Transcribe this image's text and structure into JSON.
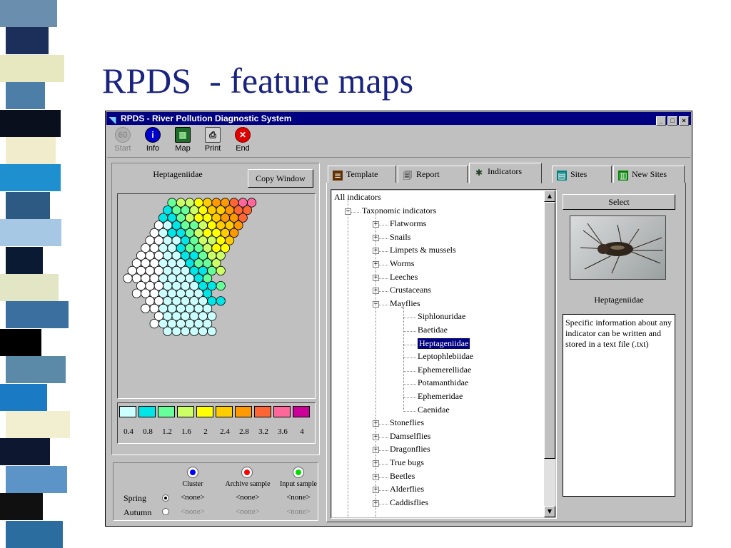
{
  "slide": {
    "title": "RPDS  - feature maps"
  },
  "window": {
    "title": "RPDS - River Pollution Diagnostic System"
  },
  "toolbar": {
    "buttons": [
      {
        "label": "Start",
        "icon": "start-icon",
        "enabled": false
      },
      {
        "label": "Info",
        "icon": "info-icon",
        "enabled": true
      },
      {
        "label": "Map",
        "icon": "map-icon",
        "enabled": true
      },
      {
        "label": "Print",
        "icon": "printer-icon",
        "enabled": true
      },
      {
        "label": "End",
        "icon": "stop-icon",
        "enabled": true
      }
    ]
  },
  "map_panel": {
    "title": "Heptageniidae",
    "copy_button": "Copy Window",
    "legend": {
      "colors": [
        "#ccffff",
        "#00e6e6",
        "#66ff99",
        "#ccff66",
        "#ffff00",
        "#ffcc00",
        "#ff9900",
        "#ff6633",
        "#ff6699",
        "#cc0099"
      ],
      "labels": [
        "0.4",
        "0.8",
        "1.2",
        "1.6",
        "2",
        "2.4",
        "2.8",
        "3.2",
        "3.6",
        "4"
      ]
    }
  },
  "samples": {
    "headers": [
      "Cluster",
      "Archive sample",
      "Input sample"
    ],
    "marker_colors": [
      "#0000ff",
      "#ff0000",
      "#00dd00"
    ],
    "rows": [
      {
        "label": "Spring",
        "selected": true,
        "values": [
          "<none>",
          "<none>",
          "<none>"
        ]
      },
      {
        "label": "Autumn",
        "selected": false,
        "values": [
          "<none>",
          "<none>",
          "<none>"
        ]
      }
    ]
  },
  "tabs": [
    {
      "label": "Template",
      "icon": "template-icon"
    },
    {
      "label": "Report",
      "icon": "report-icon"
    },
    {
      "label": "Indicators",
      "icon": "indicators-icon",
      "active": true
    },
    {
      "label": "Sites",
      "icon": "sites-icon"
    },
    {
      "label": "New Sites",
      "icon": "new-sites-icon"
    }
  ],
  "tree": {
    "root": "All indicators",
    "group": "Taxonomic indicators",
    "items_before": [
      "Flatworms",
      "Snails",
      "Limpets & mussels",
      "Worms",
      "Leeches",
      "Crustaceans"
    ],
    "expanded": "Mayflies",
    "children": [
      "Siphlonuridae",
      "Baetidae",
      "Heptageniidae",
      "Leptophlebiidae",
      "Ephemerellidae",
      "Potamanthidae",
      "Ephemeridae",
      "Caenidae"
    ],
    "selected": "Heptageniidae",
    "items_after": [
      "Stoneflies",
      "Damselflies",
      "Dragonflies",
      "True bugs",
      "Beetles",
      "Alderflies",
      "Caddisflies"
    ]
  },
  "right_panel": {
    "select_button": "Select",
    "image_caption": "Heptageniidae",
    "info_text": "Specific information about any indicator can be written and stored in a text file (.txt)"
  }
}
